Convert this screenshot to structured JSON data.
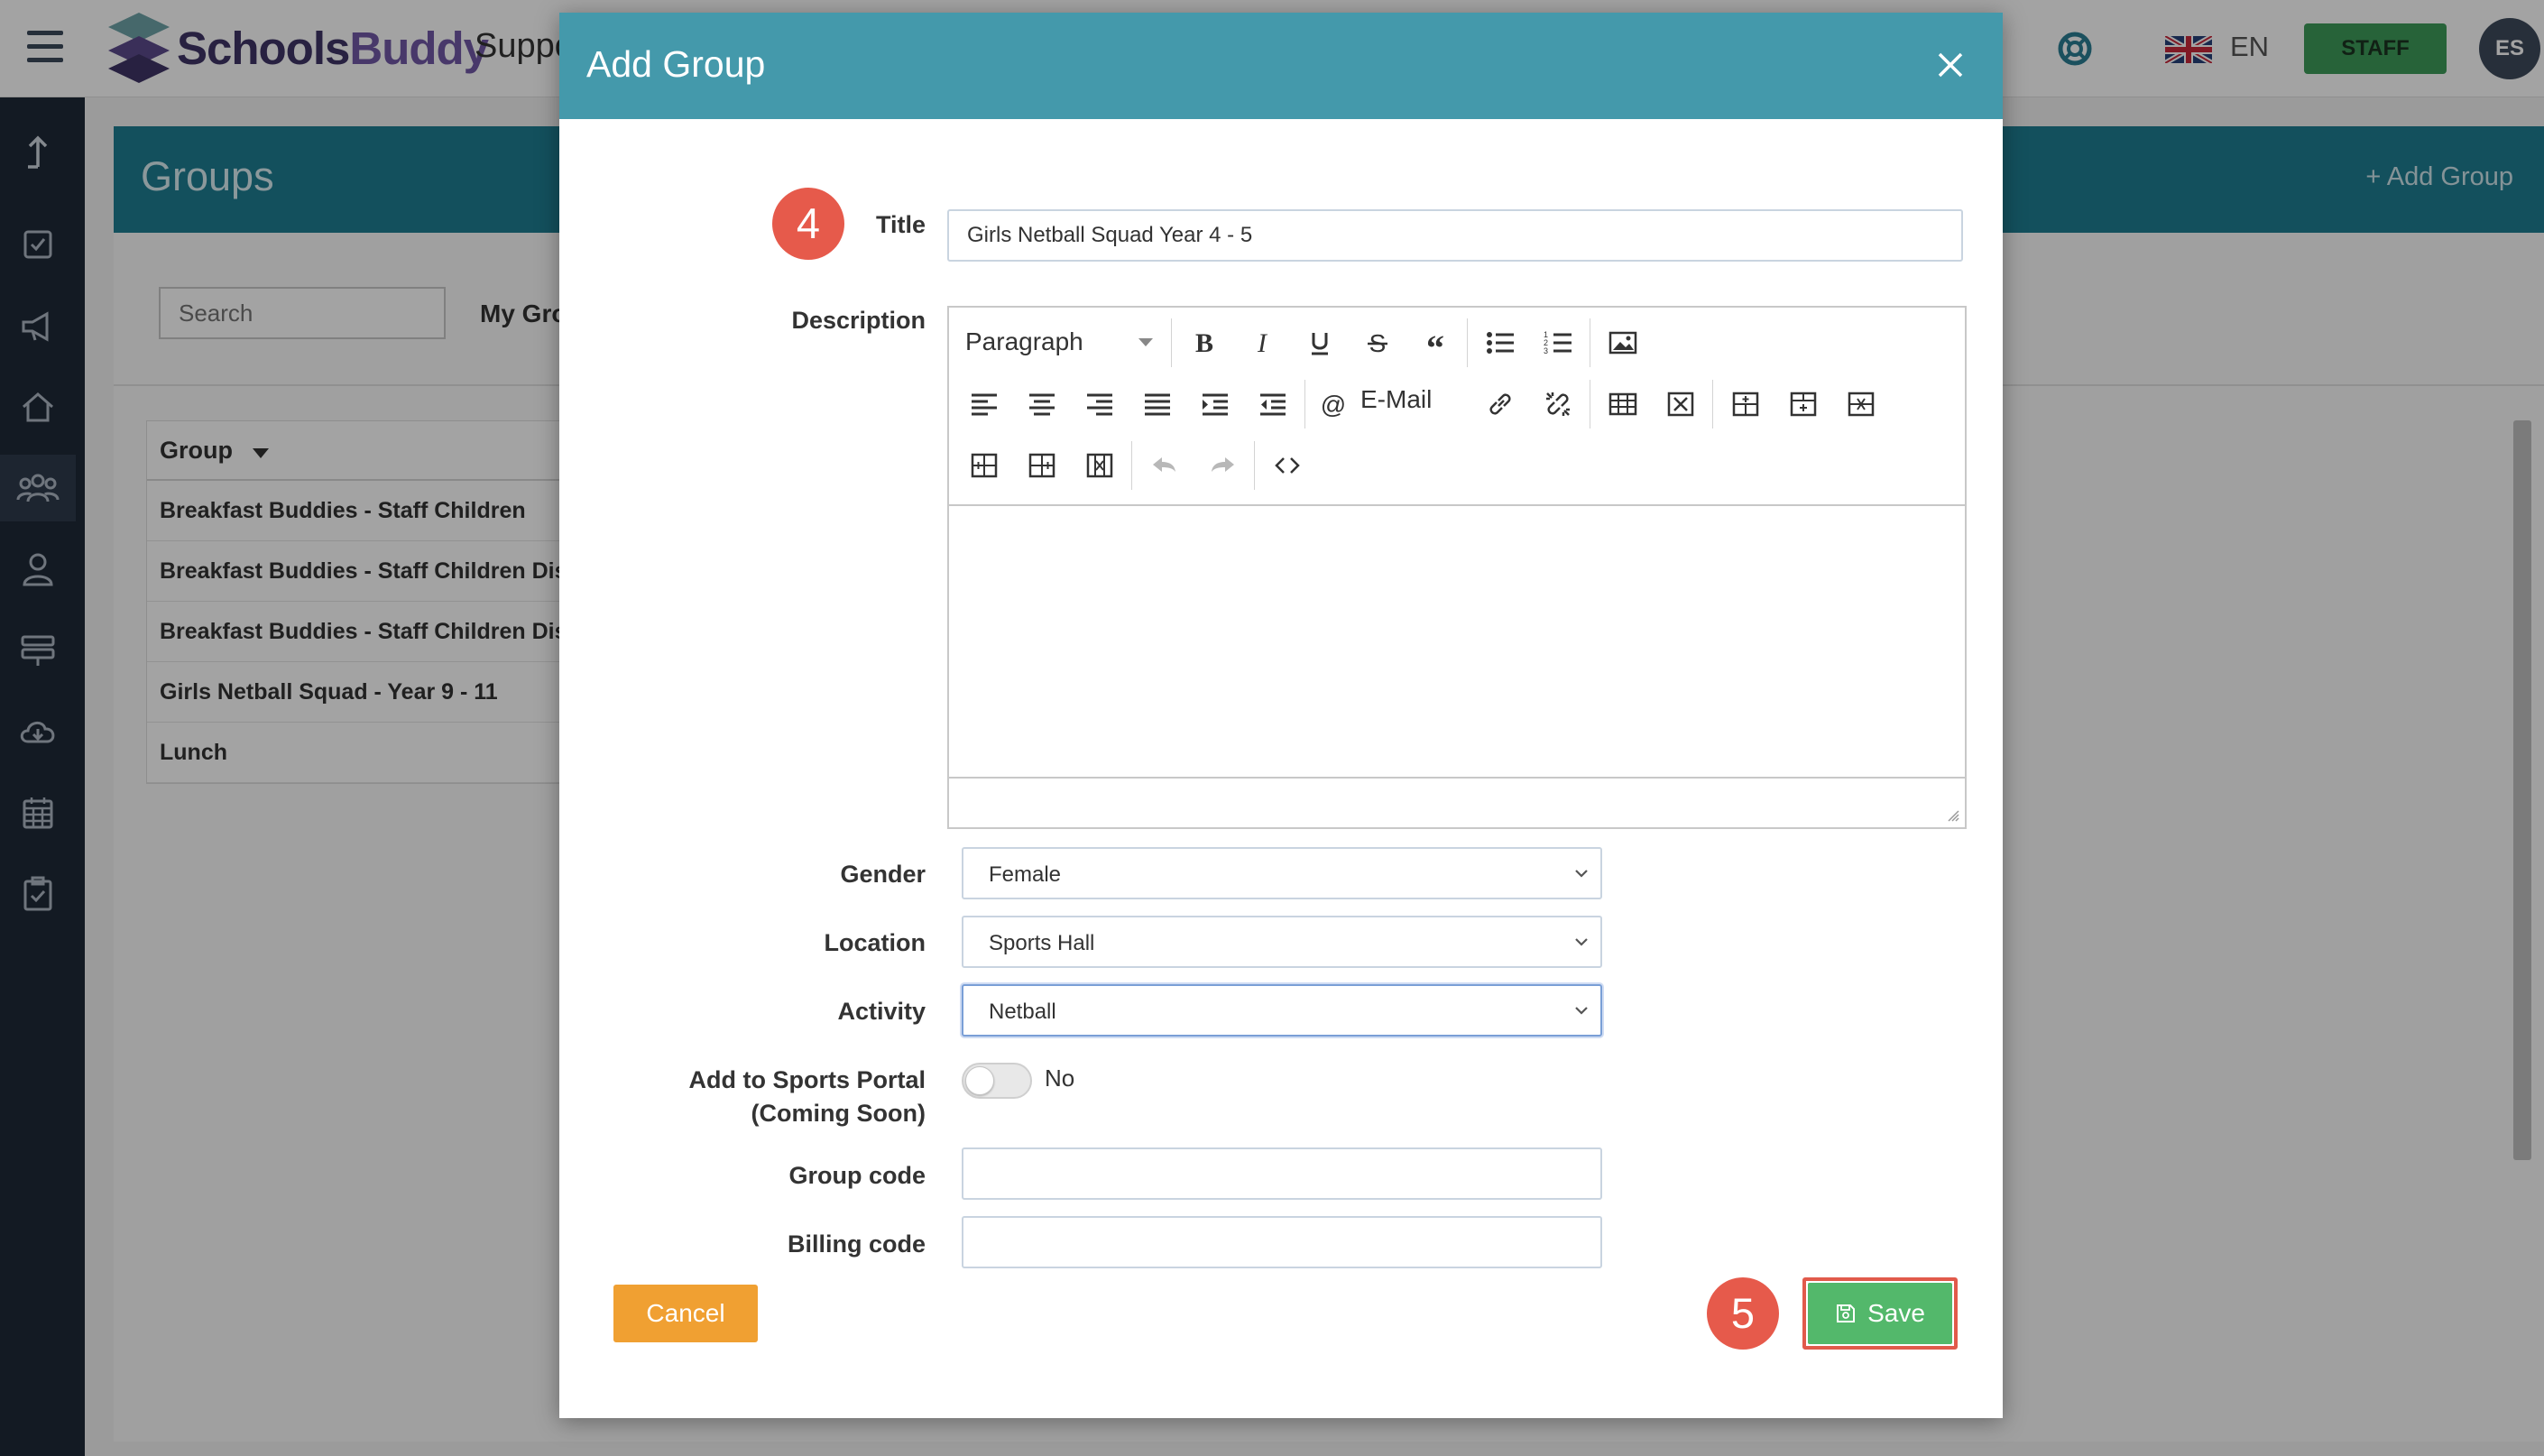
{
  "header": {
    "brand_dark": "Schools",
    "brand_light": "Buddy",
    "partial_menu": "Suppo",
    "language": "EN",
    "role_button": "STAFF",
    "avatar_initials": "ES"
  },
  "sidebar": {
    "items": [
      "log-out-icon",
      "task-check-icon",
      "megaphone-icon",
      "home-icon",
      "groups-icon",
      "user-icon",
      "signpost-icon",
      "cloud-download-icon",
      "calendar-icon",
      "clipboard-check-icon"
    ],
    "active_item": "groups-icon"
  },
  "page": {
    "title": "Groups",
    "add_group": "+ Add Group",
    "search_placeholder": "Search",
    "my_groups_tab": "My Gro",
    "table": {
      "header": "Group",
      "rows": [
        "Breakfast Buddies - Staff Children",
        "Breakfast Buddies - Staff Children Disc",
        "Breakfast Buddies - Staff Children Disc",
        "Girls Netball Squad - Year 9 - 11",
        "Lunch"
      ]
    }
  },
  "modal": {
    "title": "Add Group",
    "step_title_badge": "4",
    "step_save_badge": "5",
    "form": {
      "title_label": "Title",
      "title_value": "Girls Netball Squad Year 4 - 5",
      "description_label": "Description",
      "editor": {
        "format_select": "Paragraph",
        "email_button": "E-Mail",
        "toolbar_row1": [
          "bold-icon",
          "italic-icon",
          "underline-icon",
          "strikethrough-icon",
          "blockquote-icon",
          "bulleted-list-icon",
          "numbered-list-icon",
          "insert-image-icon"
        ],
        "toolbar_row2": [
          "align-left-icon",
          "align-center-icon",
          "align-right-icon",
          "align-justify-icon",
          "indent-icon",
          "outdent-icon",
          "email-icon",
          "link-icon",
          "unlink-icon",
          "table-icon",
          "delete-table-icon",
          "insert-row-above-icon",
          "insert-row-below-icon",
          "delete-row-icon"
        ],
        "toolbar_row3": [
          "insert-column-left-icon",
          "insert-column-right-icon",
          "delete-column-icon",
          "undo-icon",
          "redo-icon",
          "source-code-icon"
        ]
      },
      "gender_label": "Gender",
      "gender_value": "Female",
      "location_label": "Location",
      "location_value": "Sports Hall",
      "activity_label": "Activity",
      "activity_value": "Netball",
      "sports_portal_label_1": "Add to Sports Portal",
      "sports_portal_label_2": "(Coming Soon)",
      "sports_portal_value": "No",
      "group_code_label": "Group code",
      "group_code_value": "",
      "billing_code_label": "Billing code",
      "billing_code_value": ""
    },
    "cancel_button": "Cancel",
    "save_button": "Save"
  },
  "colors": {
    "modal_header": "#4499ab",
    "page_header_bar": "#1e7d92",
    "sidebar": "#1f2a38",
    "staff_button": "#3d9c59",
    "cancel_button": "#f0a032",
    "save_button": "#53b86b",
    "step_badge": "#e65a4b"
  }
}
